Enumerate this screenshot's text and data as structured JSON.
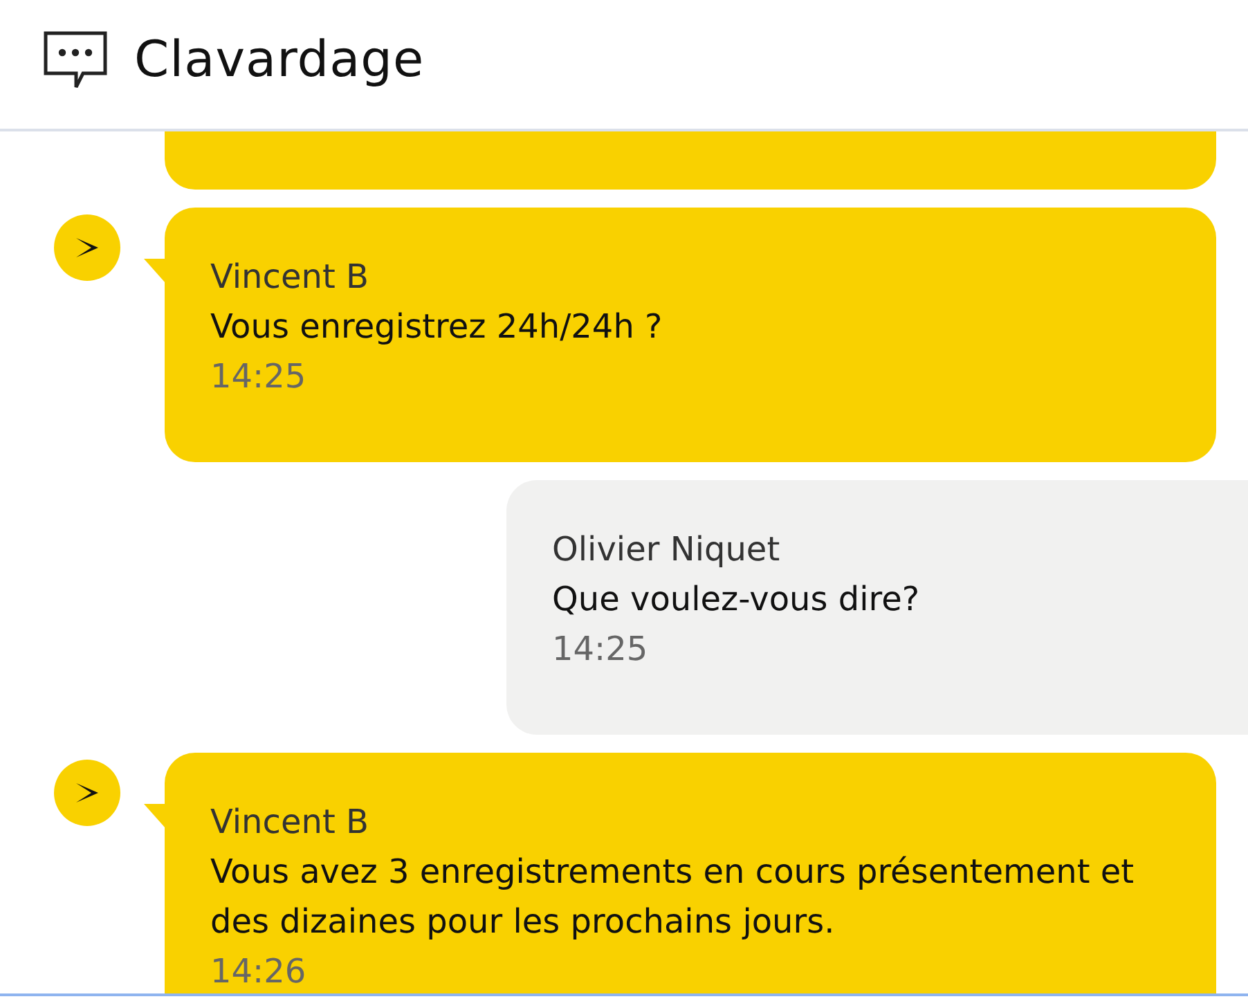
{
  "header": {
    "title": "Clavardage"
  },
  "messages": [
    {
      "kind": "agent",
      "sender": "Vincent B",
      "text": "Vous enregistrez 24h/24h ?",
      "time": "14:25"
    },
    {
      "kind": "user",
      "sender": "Olivier Niquet",
      "text": "Que voulez-vous dire?",
      "time": "14:25"
    },
    {
      "kind": "agent",
      "sender": "Vincent B",
      "text": "Vous avez 3 enregistrements en cours présentement et des dizaines pour les prochains jours.",
      "time": "14:26"
    }
  ]
}
